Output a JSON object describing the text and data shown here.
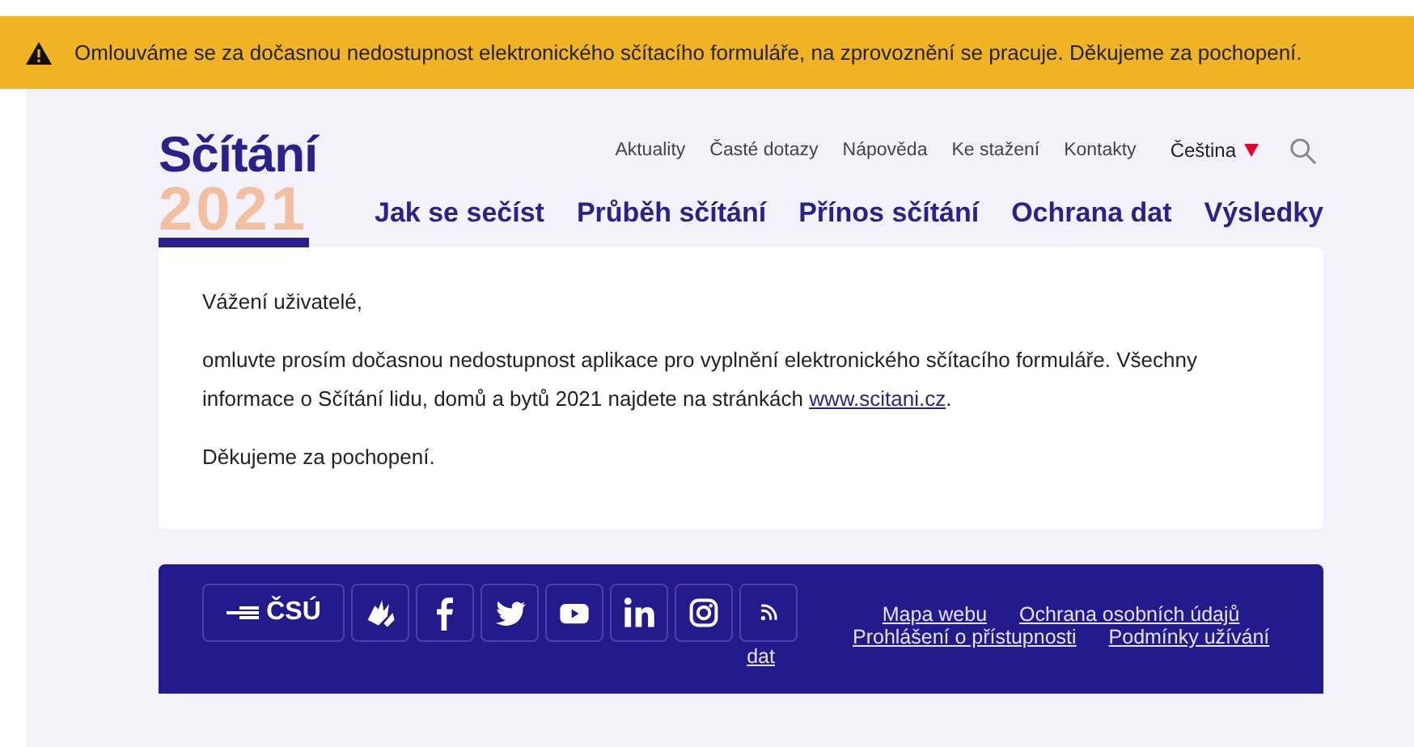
{
  "alert": {
    "text": "Omlouváme se za dočasnou nedostupnost elektronického sčítacího formuláře, na zprovoznění se pracuje. Děkujeme za pochopení."
  },
  "logo": {
    "word": "Sčítání",
    "year": "2021"
  },
  "top_nav": [
    "Aktuality",
    "Časté dotazy",
    "Nápověda",
    "Ke stažení",
    "Kontakty"
  ],
  "language": {
    "label": "Čeština",
    "expanded": false
  },
  "main_nav": [
    "Jak se sečíst",
    "Průběh sčítání",
    "Přínos sčítání",
    "Ochrana dat",
    "Výsledky"
  ],
  "message": {
    "greeting": "Vážení uživatelé,",
    "body": "omluvte prosím dočasnou nedostupnost aplikace pro vyplnění elektronického sčítacího formuláře. Všechny informace o Sčítání lidu, domů a bytů 2021 najdete na stránkách ",
    "link": "www.scitani.cz",
    "body_end": ".",
    "thanks": "Děkujeme za pochopení."
  },
  "footer": {
    "brand": "ČSÚ",
    "social": [
      {
        "kind": "sign"
      },
      {
        "kind": "facebook"
      },
      {
        "kind": "twitter"
      },
      {
        "kind": "youtube"
      },
      {
        "kind": "linkedin"
      },
      {
        "kind": "instagram"
      },
      {
        "kind": "rss"
      }
    ],
    "data_link": "dat",
    "links": [
      [
        "Mapa webu",
        "Ochrana osobních údajů"
      ],
      [
        "Prohlášení o přístupnosti",
        "Podmínky užívání"
      ]
    ]
  }
}
